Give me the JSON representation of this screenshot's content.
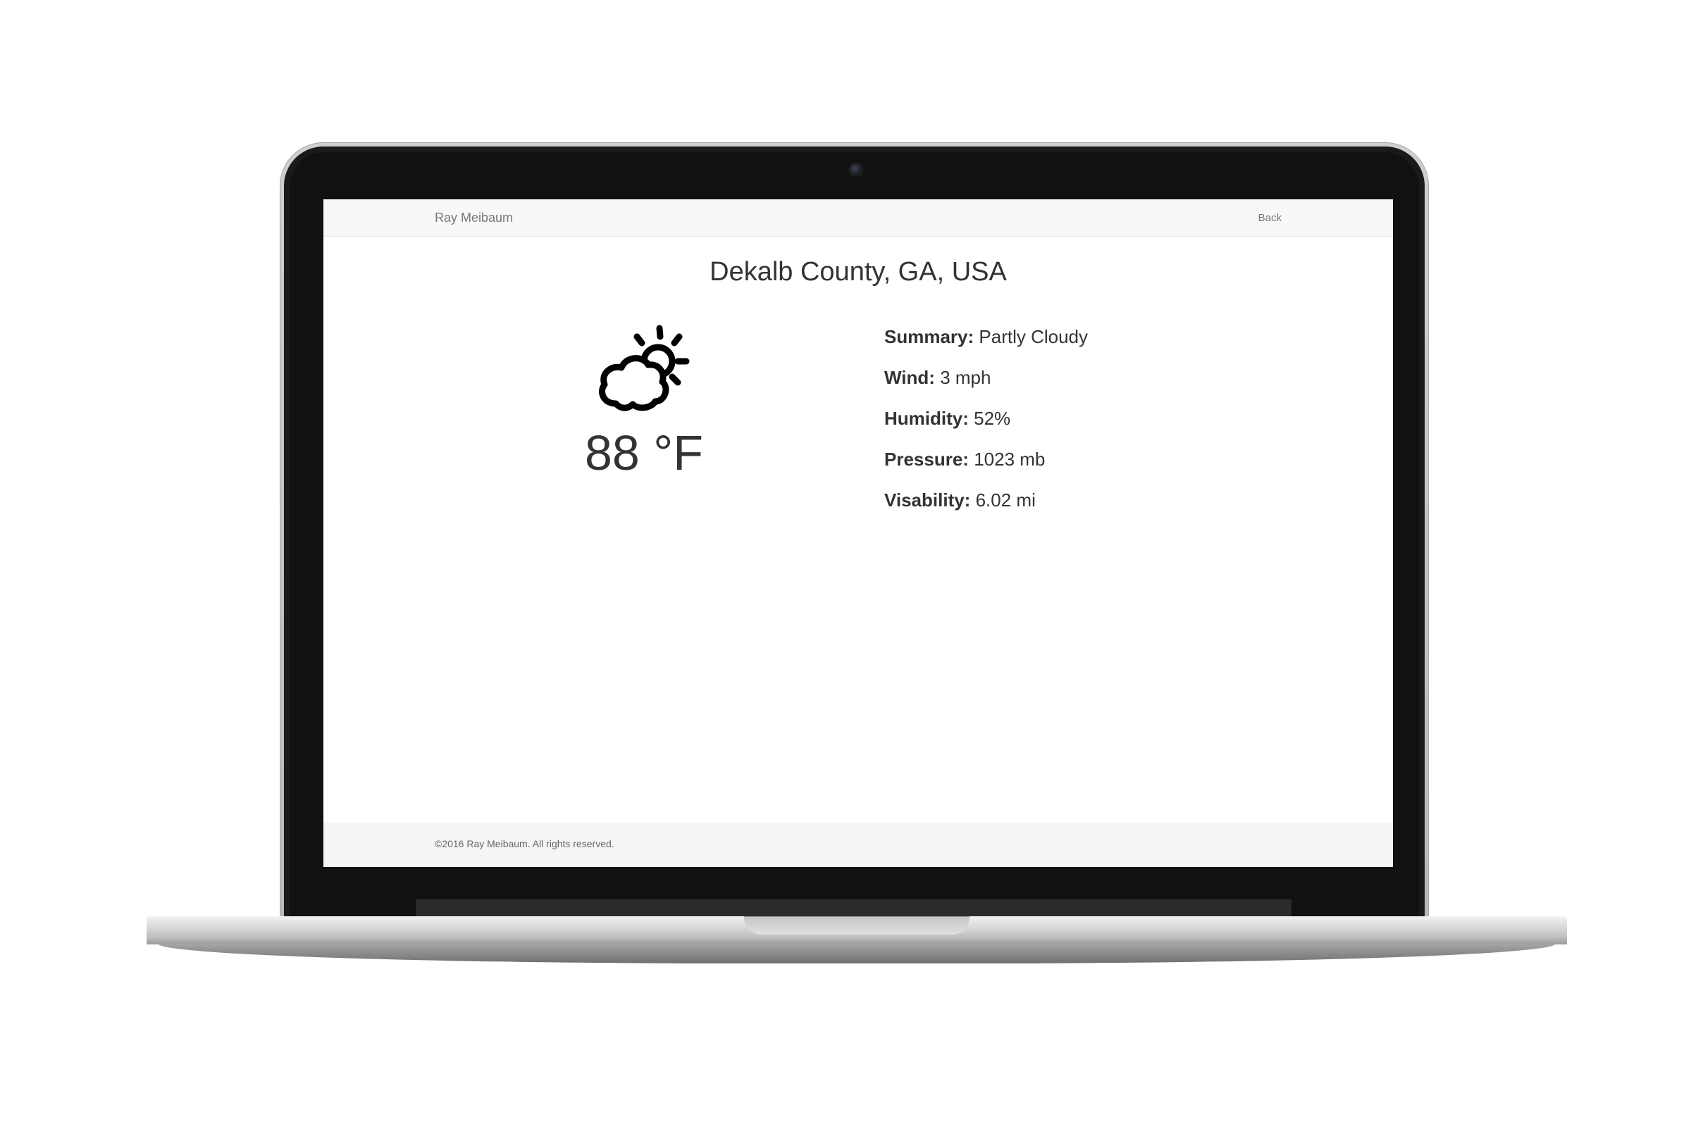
{
  "navbar": {
    "brand": "Ray Meibaum",
    "back_label": "Back"
  },
  "main": {
    "location": "Dekalb County, GA, USA",
    "icon": "partly-cloudy-day-icon",
    "temperature": "88 °F",
    "details": [
      {
        "label": "Summary:",
        "value": "Partly Cloudy"
      },
      {
        "label": "Wind:",
        "value": "3 mph"
      },
      {
        "label": "Humidity:",
        "value": "52%"
      },
      {
        "label": "Pressure:",
        "value": "1023 mb"
      },
      {
        "label": "Visability:",
        "value": "6.02 mi"
      }
    ]
  },
  "footer": {
    "copyright": "©2016 Ray Meibaum. All rights reserved."
  },
  "colors": {
    "text": "#333333",
    "navbar_bg": "#f8f8f8",
    "footer_bg": "#f5f5f5",
    "nav_text": "#777777"
  }
}
